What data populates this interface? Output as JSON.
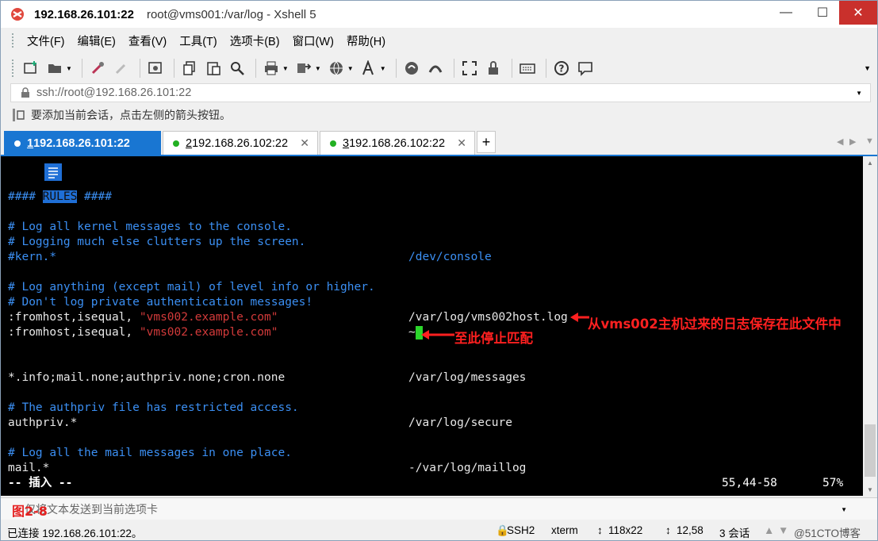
{
  "window": {
    "host": "192.168.26.101:22",
    "title_rest": "root@vms001:/var/log - Xshell 5",
    "minimize": "—",
    "maximize": "☐",
    "close": "✕"
  },
  "menu": [
    "文件(F)",
    "编辑(E)",
    "查看(V)",
    "工具(T)",
    "选项卡(B)",
    "窗口(W)",
    "帮助(H)"
  ],
  "address": {
    "value": "ssh://root@192.168.26.101:22"
  },
  "hint": "要添加当前会话，点击左侧的箭头按钮。",
  "tabs": [
    {
      "num": "1",
      "label": " 192.168.26.101:22",
      "active": true
    },
    {
      "num": "2",
      "label": " 192.168.26.102:22",
      "active": false
    },
    {
      "num": "3",
      "label": " 192.168.26.102:22",
      "active": false
    }
  ],
  "terminal": {
    "rules_pre": "#### ",
    "rules_word": "RULES",
    "rules_post": " ####",
    "l_comment1": "# Log all kernel messages to the console.",
    "l_comment2": "# Logging much else clutters up the screen.",
    "l_kern": "#kern.*",
    "l_kern_dest": "/dev/console",
    "l_comment3": "# Log anything (except mail) of level info or higher.",
    "l_comment4": "# Don't log private authentication messages!",
    "l_from1_a": ":fromhost,isequal, ",
    "l_from1_b": "\"vms002.example.com\"",
    "l_from1_dest": "/var/log/vms002host.log",
    "l_from2_a": ":fromhost,isequal, ",
    "l_from2_b": "\"vms002.example.com\"",
    "l_from2_dest": "~",
    "l_info": "*.info;mail.none;authpriv.none;cron.none",
    "l_info_dest": "/var/log/messages",
    "l_comment5": "# The authpriv file has restricted access.",
    "l_authpriv": "authpriv.*",
    "l_authpriv_dest": "/var/log/secure",
    "l_comment6": "# Log all the mail messages in one place.",
    "l_mail": "mail.*",
    "l_mail_dest": "-/var/log/maillog",
    "mode": "-- 插入 --",
    "position": "55,44-58",
    "percent": "57%"
  },
  "annotations": {
    "a1": "从vms002主机过来的日志保存在此文件中",
    "a2": "至此停止匹配",
    "figure": "图2-8"
  },
  "sendbar": "仅将文本发送到当前选项卡",
  "status": {
    "connected": "已连接 192.168.26.101:22。",
    "protocol": "SSH2",
    "term": "xterm",
    "size": "118x22",
    "cursor": "12,58",
    "sessions": "3 会话",
    "watermark": "@51CTO博客"
  },
  "colors": {
    "accent": "#1976d2",
    "terminal_bg": "#000000",
    "comment": "#3b8ff3",
    "string": "#d23a3a",
    "annotation": "#ff2020",
    "close_button": "#c9302c"
  }
}
